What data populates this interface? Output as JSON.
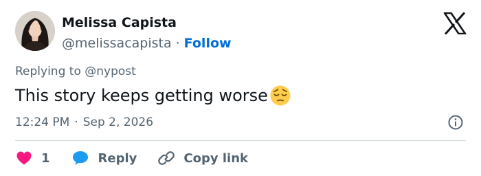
{
  "author": {
    "name": "Melissa Capista",
    "handle": "@melissacapista",
    "separator": "·",
    "follow_label": "Follow"
  },
  "reply_to": "Replying to @nypost",
  "tweet": {
    "text": "This story keeps getting worse",
    "emoji": "pensive-face-emoji"
  },
  "meta": {
    "time": "12:24 PM",
    "separator": "·",
    "date": "Sep 2, 2026"
  },
  "actions": {
    "like_count": "1",
    "reply_label": "Reply",
    "copy_link_label": "Copy link"
  },
  "icons": {
    "logo": "x-logo-icon",
    "info": "info-icon",
    "like": "heart-icon",
    "reply": "speech-bubble-icon",
    "copy": "link-icon"
  },
  "colors": {
    "text_primary": "#0f1419",
    "text_secondary": "#536471",
    "follow_blue": "#006fd6",
    "heart": "#f91880",
    "reply_bubble": "#1d9bf0",
    "divider": "#cfd9de"
  }
}
